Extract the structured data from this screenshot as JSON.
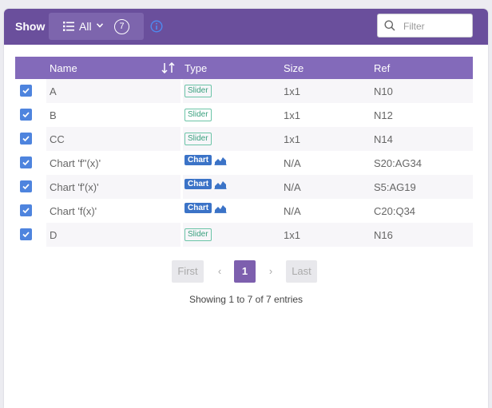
{
  "toolbar": {
    "show_label": "Show",
    "filter_value": "All",
    "count": "7",
    "search_placeholder": "Filter"
  },
  "table": {
    "columns": [
      "Name",
      "Type",
      "Size",
      "Ref"
    ],
    "rows": [
      {
        "checked": true,
        "name": "A",
        "type": "Slider",
        "size": "1x1",
        "ref": "N10"
      },
      {
        "checked": true,
        "name": "B",
        "type": "Slider",
        "size": "1x1",
        "ref": "N12"
      },
      {
        "checked": true,
        "name": "CC",
        "type": "Slider",
        "size": "1x1",
        "ref": "N14"
      },
      {
        "checked": true,
        "name": "Chart 'f''(x)'",
        "type": "Chart",
        "size": "N/A",
        "ref": "S20:AG34"
      },
      {
        "checked": true,
        "name": "Chart 'f'(x)'",
        "type": "Chart",
        "size": "N/A",
        "ref": "S5:AG19"
      },
      {
        "checked": true,
        "name": "Chart 'f(x)'",
        "type": "Chart",
        "size": "N/A",
        "ref": "C20:Q34"
      },
      {
        "checked": true,
        "name": "D",
        "type": "Slider",
        "size": "1x1",
        "ref": "N16"
      }
    ]
  },
  "pagination": {
    "first": "First",
    "prev": "‹",
    "current": "1",
    "next": "›",
    "last": "Last"
  },
  "footer": {
    "entries_text": "Showing 1 to 7 of 7 entries"
  },
  "colors": {
    "header_bar": "#6a4f9c",
    "table_header": "#836aba",
    "checkbox": "#4e84de",
    "chart_badge": "#3b73c7",
    "slider_badge": "#39a07e",
    "active_page": "#7d5fae"
  },
  "icons": {
    "list": "list-icon",
    "chevron": "chevron-down-icon",
    "info": "info-icon",
    "search": "search-icon",
    "sort": "sort-icon",
    "check": "checkmark-icon",
    "area_chart": "area-chart-icon"
  }
}
